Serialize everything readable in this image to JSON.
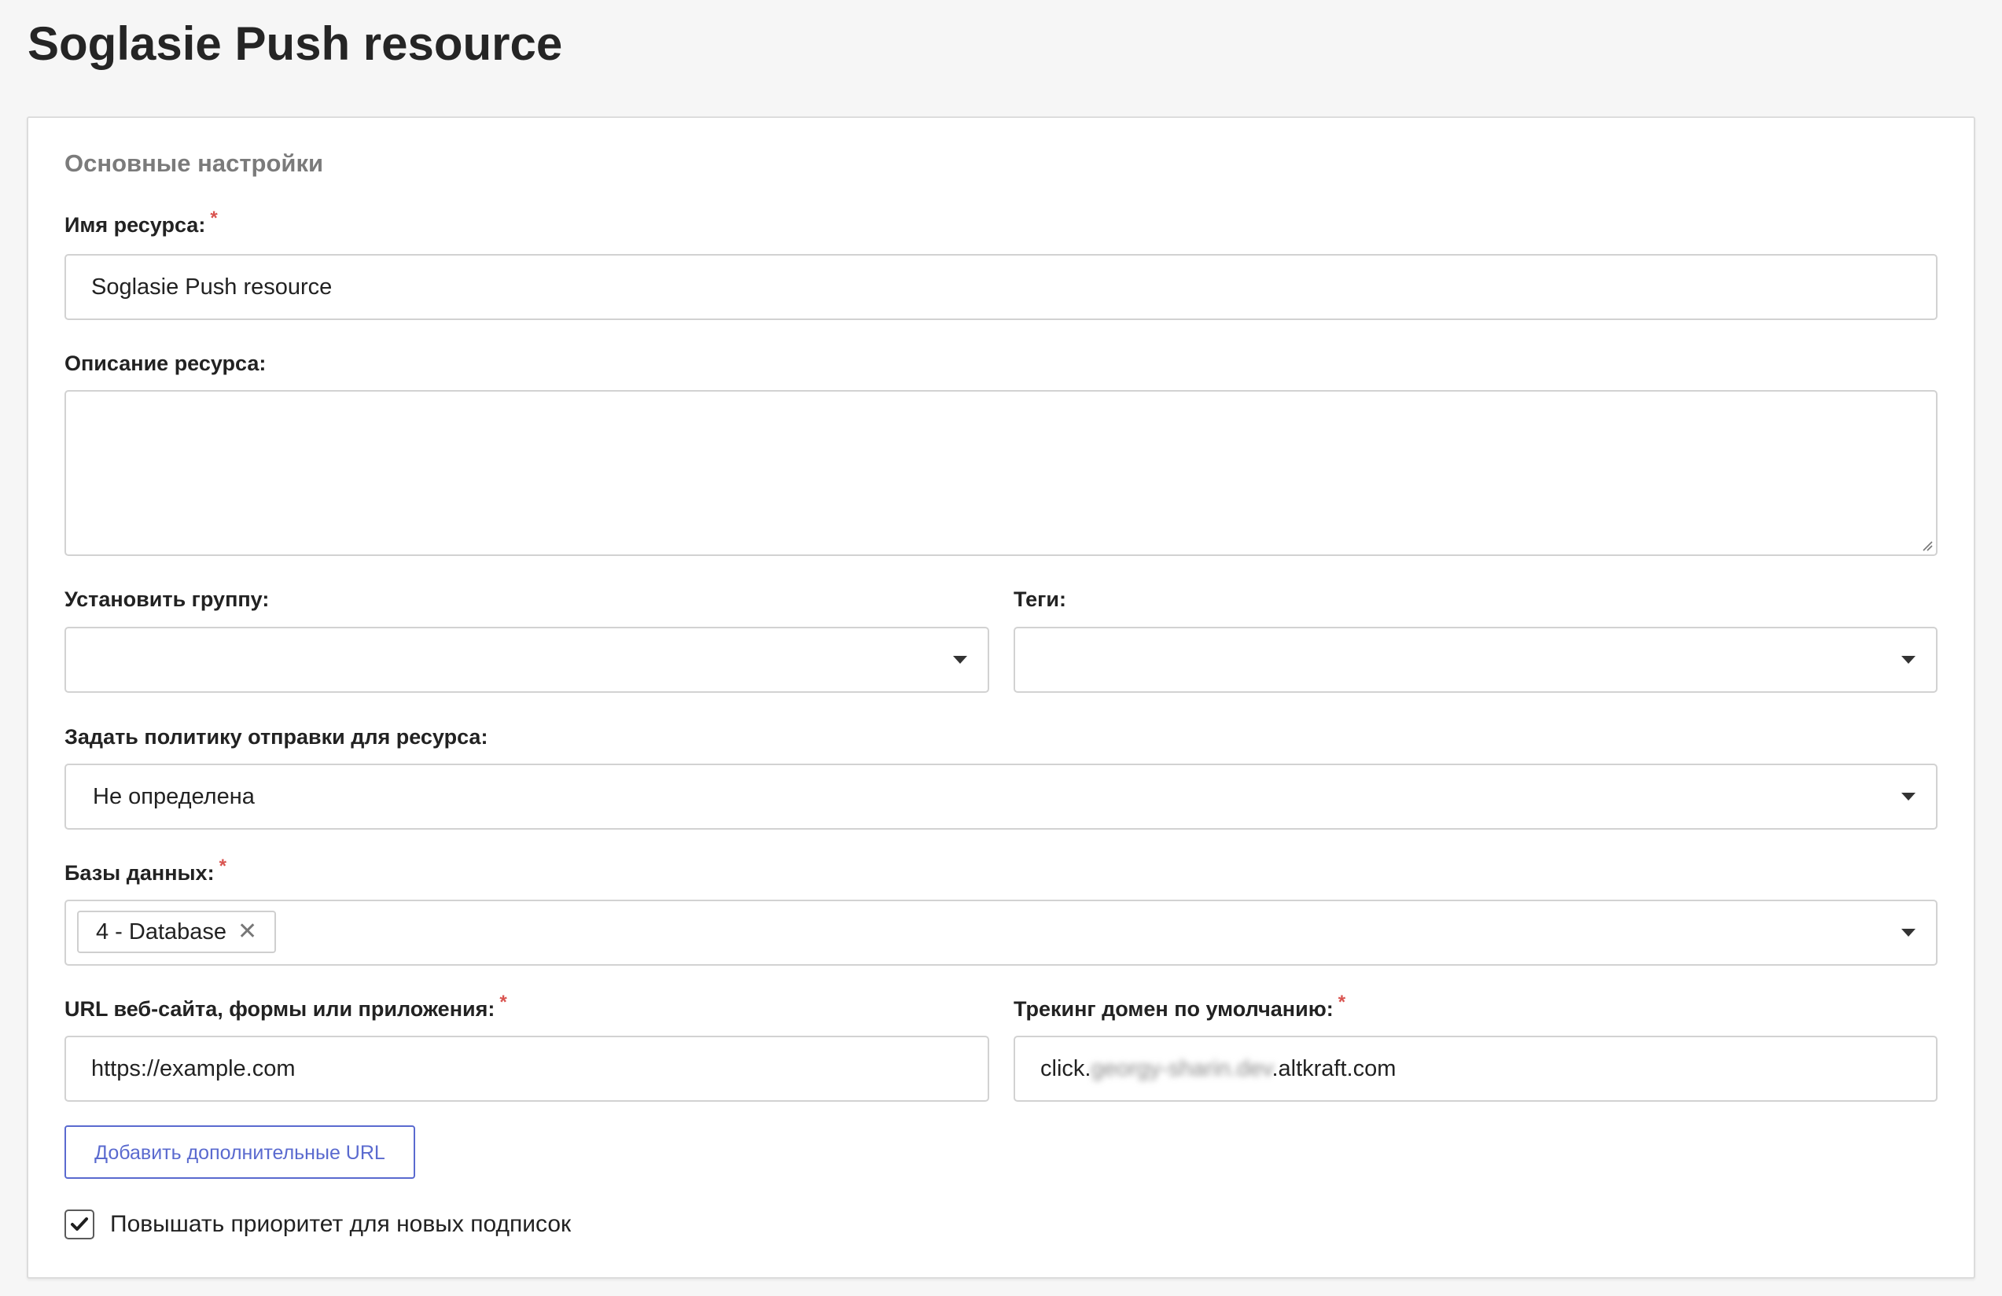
{
  "page": {
    "title": "Soglasie Push resource"
  },
  "section": {
    "title": "Основные настройки"
  },
  "fields": {
    "name": {
      "label": "Имя ресурса:",
      "required_mark": "*",
      "value": "Soglasie Push resource"
    },
    "description": {
      "label": "Описание ресурса:",
      "value": ""
    },
    "group": {
      "label": "Установить группу:",
      "value": "",
      "icon": "chevron-down-icon"
    },
    "tags": {
      "label": "Теги:",
      "value": "",
      "icon": "chevron-down-icon"
    },
    "policy": {
      "label": "Задать политику отправки для ресурса:",
      "value": "Не определена",
      "icon": "chevron-down-icon"
    },
    "databases": {
      "label": "Базы данных:",
      "required_mark": "*",
      "selected": [
        {
          "label": "4 - Database",
          "remove_icon": "close-icon",
          "remove_glyph": "✕"
        }
      ],
      "icon": "chevron-down-icon"
    },
    "url": {
      "label": "URL веб-сайта, формы или приложения:",
      "required_mark": "*",
      "value": "https://example.com"
    },
    "tracking_domain": {
      "label": "Трекинг домен по умолчанию:",
      "required_mark": "*",
      "value_prefix": "click.",
      "value_blurred": "georgy-sharin.dev",
      "value_suffix": ".altkraft.com"
    }
  },
  "actions": {
    "add_urls_label": "Добавить дополнительные URL"
  },
  "options": {
    "priority_checkbox": {
      "label": "Повышать приоритет для новых подписок",
      "checked": true
    }
  },
  "colors": {
    "accent": "#5a6acf",
    "required": "#d9534f",
    "section_title": "#7b7b7b",
    "border": "#d2d2d2",
    "background": "#f6f6f6"
  }
}
